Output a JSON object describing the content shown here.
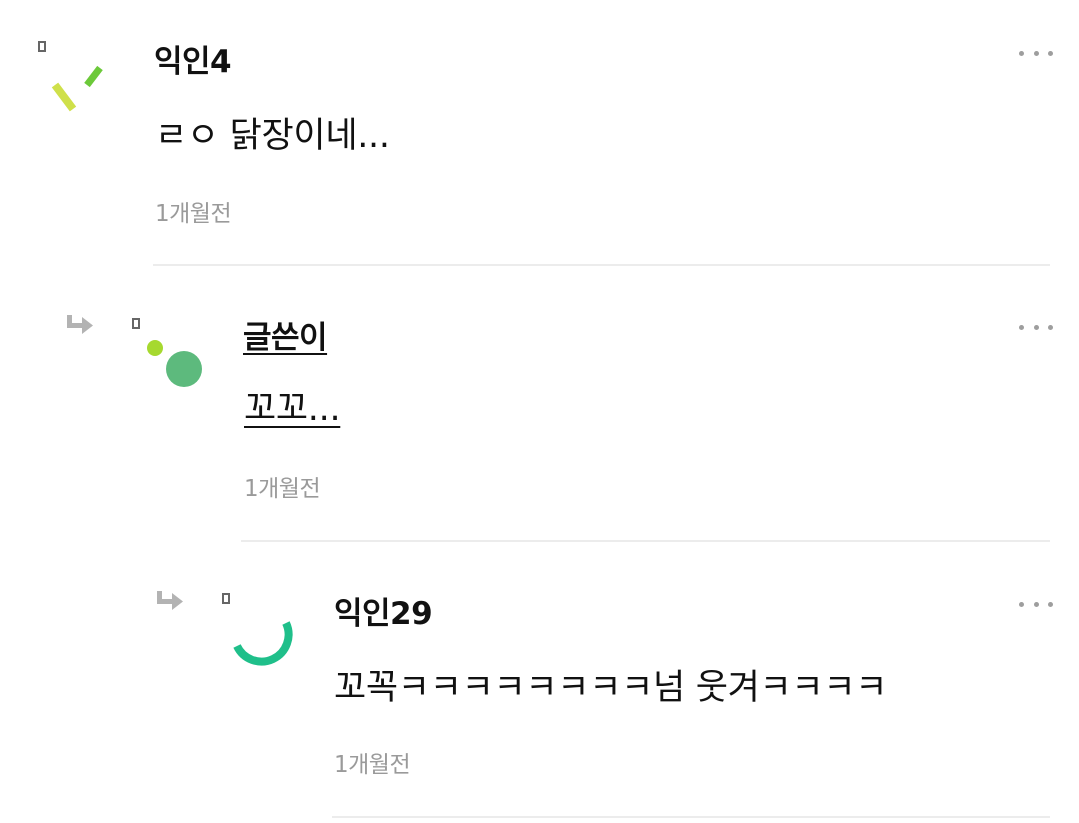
{
  "comments": [
    {
      "author": "익인4",
      "body": "ㄹㅇ 닭장이네...",
      "time": "1개월전",
      "is_writer": false
    },
    {
      "author": "글쓴이",
      "body": "꼬꼬...",
      "time": "1개월전",
      "is_writer": true
    },
    {
      "author": "익인29",
      "body": "꼬꼭ㅋㅋㅋㅋㅋㅋㅋㅋ넘 웃겨ㅋㅋㅋㅋ",
      "time": "1개월전",
      "is_writer": false
    }
  ],
  "icons": {
    "more": "more-dots-icon",
    "reply": "reply-arrow-icon",
    "marker": "anonymous-marker-icon"
  },
  "colors": {
    "author_text": "#111111",
    "time_text": "#9a9a9a",
    "divider": "#ececec",
    "more_dots": "#9e9e9e",
    "reply_arrow": "#b3b3b3",
    "avatar_yellow_green": "#cfe04a",
    "avatar_green": "#6cc93a",
    "avatar_lime": "#a6d92f",
    "avatar_mint": "#5dba7d",
    "avatar_teal": "#1fbf8a"
  }
}
